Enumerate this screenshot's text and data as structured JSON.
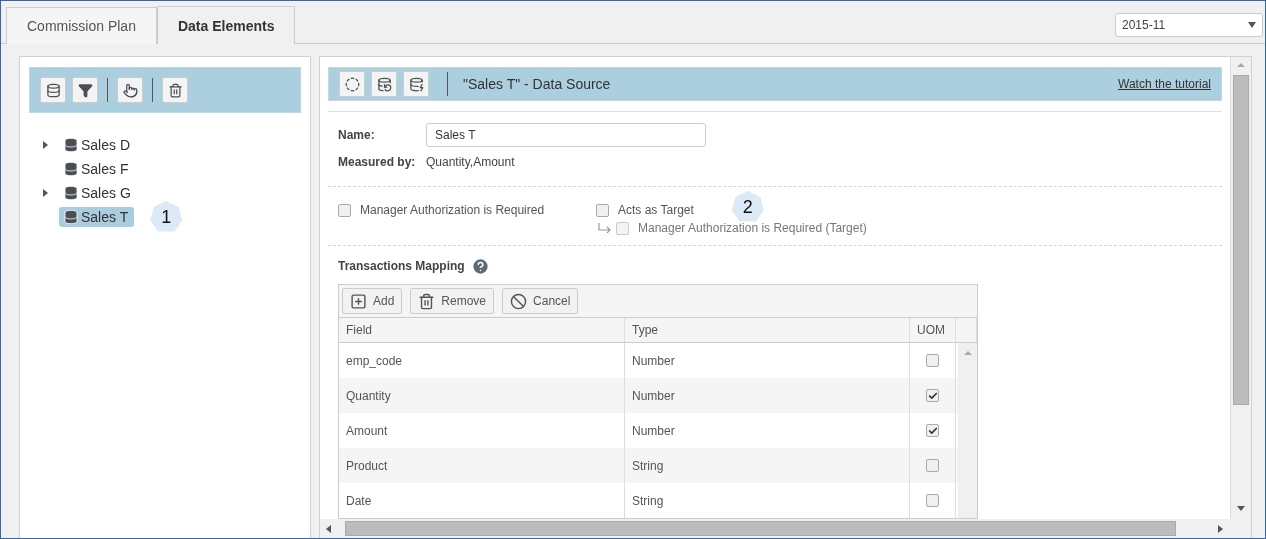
{
  "tabs": [
    {
      "label": "Commission Plan",
      "selected": false
    },
    {
      "label": "Data Elements",
      "selected": true
    }
  ],
  "period": {
    "value": "2015-11"
  },
  "tree": {
    "items": [
      {
        "label": "Sales D",
        "expandable": true,
        "selected": false
      },
      {
        "label": "Sales F",
        "expandable": false,
        "selected": false
      },
      {
        "label": "Sales G",
        "expandable": true,
        "selected": false
      },
      {
        "label": "Sales T",
        "expandable": false,
        "selected": true,
        "callout": "1"
      }
    ]
  },
  "detail": {
    "title": "\"Sales T\" - Data Source",
    "tutorial_link": "Watch the tutorial",
    "name_label": "Name:",
    "name_value": "Sales T",
    "measured_label": "Measured by:",
    "measured_value": "Quantity,Amount",
    "options": [
      {
        "label": "Manager Authorization is Required",
        "checked": false,
        "disabled": false
      },
      {
        "label": "Acts as Target",
        "checked": false,
        "disabled": false,
        "callout": "2"
      },
      {
        "label": "Manager Authorization is Required (Target)",
        "checked": false,
        "disabled": true
      }
    ],
    "mapping_title": "Transactions Mapping",
    "mapping_buttons": [
      {
        "kind": "add",
        "label": "Add"
      },
      {
        "kind": "remove",
        "label": "Remove"
      },
      {
        "kind": "cancel",
        "label": "Cancel"
      }
    ],
    "columns": [
      "Field",
      "Type",
      "UOM"
    ],
    "rows": [
      {
        "field": "emp_code",
        "type": "Number",
        "uom": false
      },
      {
        "field": "Quantity",
        "type": "Number",
        "uom": true
      },
      {
        "field": "Amount",
        "type": "Number",
        "uom": true
      },
      {
        "field": "Product",
        "type": "String",
        "uom": false
      },
      {
        "field": "Date",
        "type": "String",
        "uom": false
      }
    ]
  }
}
